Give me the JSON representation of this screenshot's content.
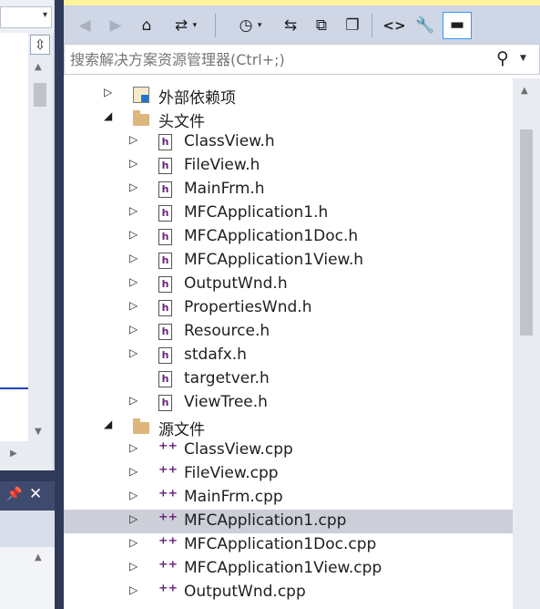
{
  "editor_left": {
    "dropdown_arrow": "▾",
    "split_icon": "split-icon",
    "pin_icon": "pin-icon",
    "close_icon": "close-icon"
  },
  "solution_explorer": {
    "toolbar": {
      "buttons": [
        {
          "name": "back-icon",
          "glyph": "⭠"
        },
        {
          "name": "forward-icon",
          "glyph": "⭢"
        },
        {
          "name": "home-icon",
          "glyph": "⌂"
        },
        {
          "name": "switch-views-icon",
          "glyph": "⇄"
        },
        {
          "name": "pending-changes-filter-icon",
          "glyph": "◷"
        },
        {
          "name": "sync-with-document-icon",
          "glyph": "⇆"
        },
        {
          "name": "collapse-all-icon",
          "glyph": "⧉"
        },
        {
          "name": "show-all-files-icon",
          "glyph": "❐"
        },
        {
          "name": "view-code-icon",
          "glyph": "<>"
        },
        {
          "name": "properties-icon",
          "glyph": "🔧"
        },
        {
          "name": "preview-selected-items-icon",
          "glyph": "▬"
        }
      ]
    },
    "search": {
      "placeholder": "搜索解决方案资源管理器(Ctrl+;)",
      "icon": "search-icon"
    },
    "tree": [
      {
        "label": "外部依赖项",
        "icon": "references-icon",
        "expand": "▷",
        "depth": 0
      },
      {
        "label": "头文件",
        "icon": "folder-icon",
        "expand": "◢",
        "depth": 0
      },
      {
        "label": "ClassView.h",
        "icon": "header-file-icon",
        "expand": "▷",
        "depth": 1
      },
      {
        "label": "FileView.h",
        "icon": "header-file-icon",
        "expand": "▷",
        "depth": 1
      },
      {
        "label": "MainFrm.h",
        "icon": "header-file-icon",
        "expand": "▷",
        "depth": 1
      },
      {
        "label": "MFCApplication1.h",
        "icon": "header-file-icon",
        "expand": "▷",
        "depth": 1
      },
      {
        "label": "MFCApplication1Doc.h",
        "icon": "header-file-icon",
        "expand": "▷",
        "depth": 1
      },
      {
        "label": "MFCApplication1View.h",
        "icon": "header-file-icon",
        "expand": "▷",
        "depth": 1
      },
      {
        "label": "OutputWnd.h",
        "icon": "header-file-icon",
        "expand": "▷",
        "depth": 1
      },
      {
        "label": "PropertiesWnd.h",
        "icon": "header-file-icon",
        "expand": "▷",
        "depth": 1
      },
      {
        "label": "Resource.h",
        "icon": "header-file-icon",
        "expand": "▷",
        "depth": 1
      },
      {
        "label": "stdafx.h",
        "icon": "header-file-icon",
        "expand": "▷",
        "depth": 1
      },
      {
        "label": "targetver.h",
        "icon": "header-file-icon",
        "expand": "",
        "depth": 1
      },
      {
        "label": "ViewTree.h",
        "icon": "header-file-icon",
        "expand": "▷",
        "depth": 1
      },
      {
        "label": "源文件",
        "icon": "folder-icon",
        "expand": "◢",
        "depth": 0
      },
      {
        "label": "ClassView.cpp",
        "icon": "cpp-file-icon",
        "expand": "▷",
        "depth": 1
      },
      {
        "label": "FileView.cpp",
        "icon": "cpp-file-icon",
        "expand": "▷",
        "depth": 1
      },
      {
        "label": "MainFrm.cpp",
        "icon": "cpp-file-icon",
        "expand": "▷",
        "depth": 1
      },
      {
        "label": "MFCApplication1.cpp",
        "icon": "cpp-file-icon",
        "expand": "▷",
        "depth": 1,
        "selected": true
      },
      {
        "label": "MFCApplication1Doc.cpp",
        "icon": "cpp-file-icon",
        "expand": "▷",
        "depth": 1
      },
      {
        "label": "MFCApplication1View.cpp",
        "icon": "cpp-file-icon",
        "expand": "▷",
        "depth": 1
      },
      {
        "label": "OutputWnd.cpp",
        "icon": "cpp-file-icon",
        "expand": "▷",
        "depth": 1
      }
    ]
  },
  "colors": {
    "accent": "#3399ff",
    "selection": "#ccced8",
    "file_icon": "#68217a",
    "folder": "#dcb67a",
    "frame": "#2f3a5a"
  }
}
